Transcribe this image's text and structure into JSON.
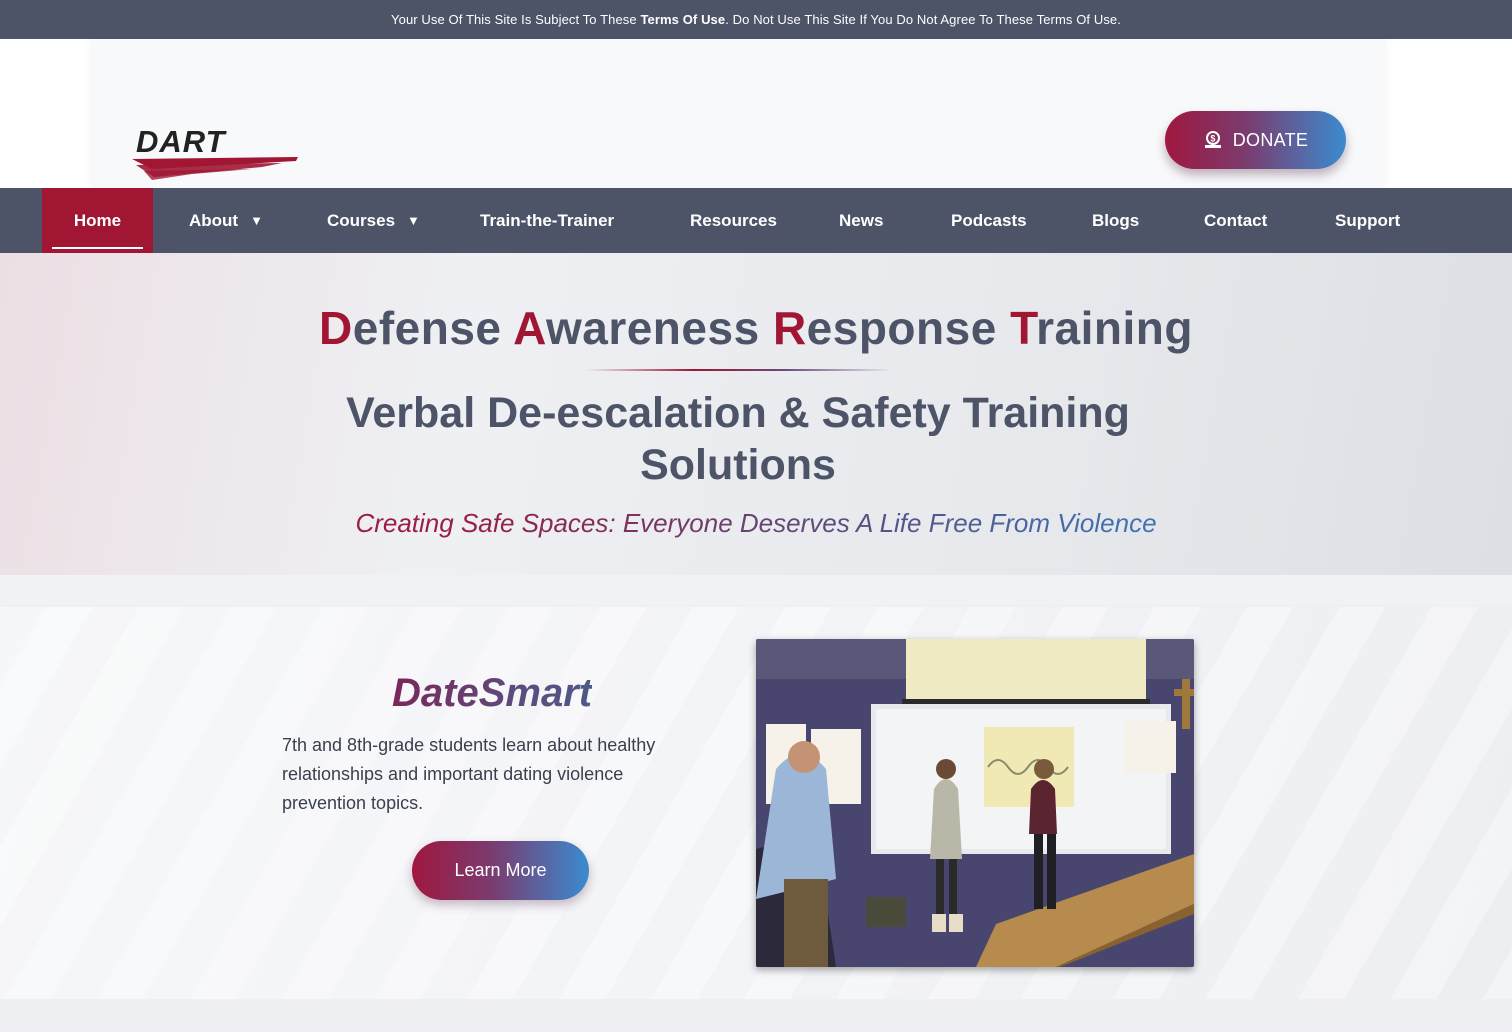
{
  "topbar": {
    "prefix": "Your Use Of This Site Is Subject To These ",
    "terms_link": "Terms Of Use",
    "suffix": ". Do Not Use This Site If You Do Not Agree To These Terms Of Use."
  },
  "header": {
    "logo_text": "DART",
    "donate_label": "DONATE",
    "donate_icon": "hand-dollar-icon"
  },
  "nav": {
    "items": [
      {
        "label": "Home",
        "active": true
      },
      {
        "label": "About",
        "caret": "▼"
      },
      {
        "label": "Courses",
        "caret": "▼"
      },
      {
        "label": "Train-the-Trainer"
      },
      {
        "label": "Resources"
      },
      {
        "label": "News"
      },
      {
        "label": "Podcasts"
      },
      {
        "label": "Blogs"
      },
      {
        "label": "Contact"
      },
      {
        "label": "Support"
      }
    ]
  },
  "hero": {
    "title_words": [
      {
        "cap": "D",
        "rest": "efense "
      },
      {
        "cap": "A",
        "rest": "wareness "
      },
      {
        "cap": "R",
        "rest": "esponse "
      },
      {
        "cap": "T",
        "rest": "raining"
      }
    ],
    "subtitle": "Verbal De-escalation & Safety Training Solutions",
    "tagline": "Creating Safe Spaces: Everyone Deserves A Life Free From Violence"
  },
  "datesmart": {
    "title": "DateSmart",
    "description": "7th and 8th-grade students learn about healthy relationships and important dating violence prevention topics.",
    "button_label": "Learn More"
  },
  "colors": {
    "brand_red": "#a01633",
    "nav_bg": "#4d5468",
    "accent_blue": "#3a8bd0"
  }
}
